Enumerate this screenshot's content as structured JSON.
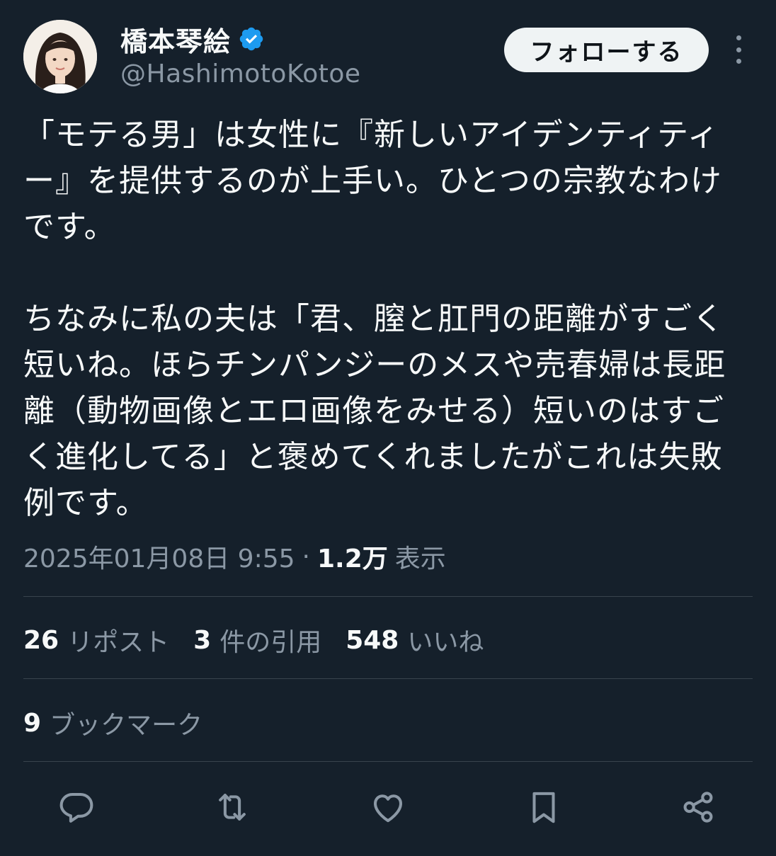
{
  "author": {
    "display_name": "橋本琴絵",
    "handle": "@HashimotoKotoe",
    "verified": true
  },
  "follow_button_label": "フォローする",
  "tweet": {
    "text": "「モテる男」は女性に『新しいアイデンティティー』を提供するのが上手い。ひとつの宗教なわけです。\n\nちなみに私の夫は「君、膣と肛門の距離がすごく短いね。ほらチンパンジーのメスや売春婦は長距離（動物画像とエロ画像をみせる）短いのはすごく進化してる」と褒めてくれましたがこれは失敗例です。",
    "timestamp": "2025年01月08日 9:55",
    "separator": "·",
    "views_count": "1.2万",
    "views_label": "表示"
  },
  "stats": {
    "reposts": {
      "count": "26",
      "label": "リポスト"
    },
    "quotes": {
      "count": "3",
      "label": "件の引用"
    },
    "likes": {
      "count": "548",
      "label": "いいね"
    }
  },
  "bookmarks": {
    "count": "9",
    "label": "ブックマーク"
  },
  "actions": [
    "reply-icon",
    "repost-icon",
    "like-icon",
    "bookmark-icon",
    "share-icon"
  ],
  "colors": {
    "background": "#15202b",
    "text_primary": "#f7f9f9",
    "text_secondary": "#8b98a5",
    "divider": "#38444d",
    "verified_blue": "#1d9bf0"
  }
}
